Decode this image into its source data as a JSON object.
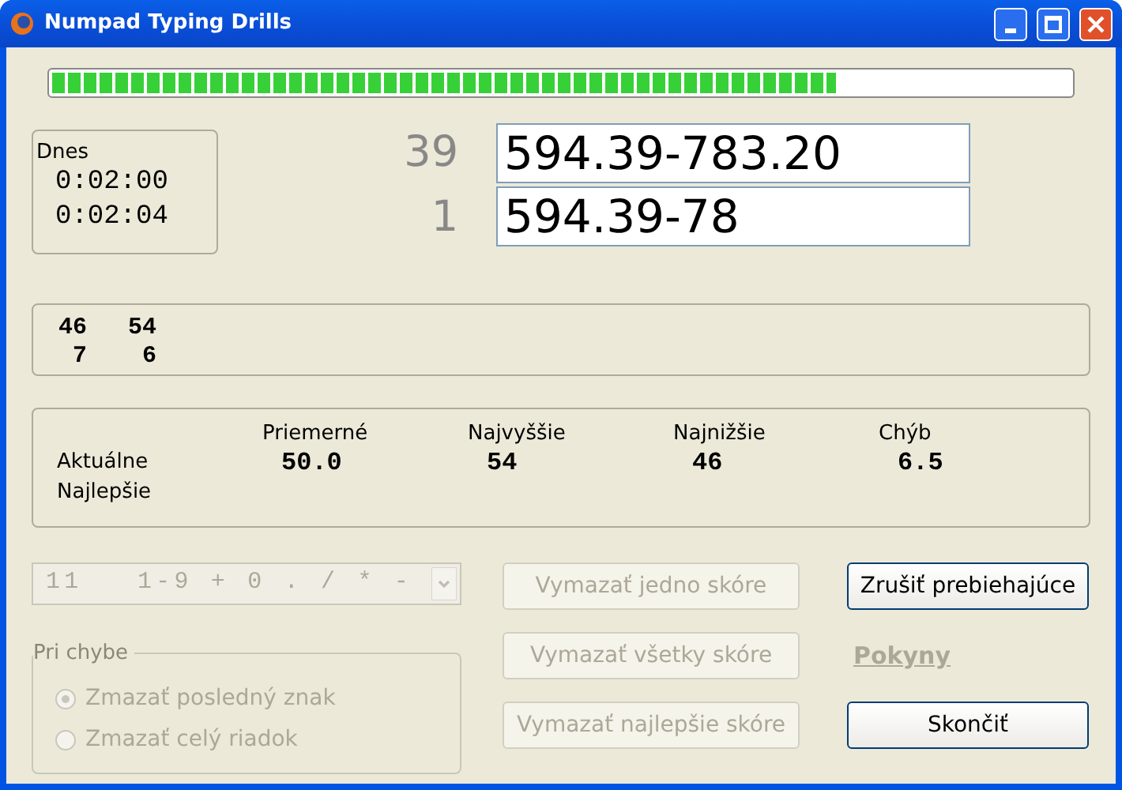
{
  "window": {
    "title": "Numpad Typing Drills"
  },
  "progress": {
    "level": 0.77
  },
  "today": {
    "label": "Dnes",
    "times": [
      "0:02:00",
      "0:02:04"
    ]
  },
  "lines": [
    {
      "count": "39",
      "text": "594.39-783.20"
    },
    {
      "count": "1",
      "text": "594.39-78"
    }
  ],
  "stats": {
    "rows": [
      [
        "46",
        "54"
      ],
      [
        "7",
        "6"
      ]
    ]
  },
  "scores": {
    "columns": [
      "Priemerné",
      "Najvyššie",
      "Najnižšie",
      "Chýb"
    ],
    "rows": [
      {
        "label": "Aktuálne",
        "values": [
          "50.0",
          "54",
          "46",
          "6.5"
        ]
      },
      {
        "label": "Najlepšie"
      }
    ]
  },
  "drill_select": {
    "value": "11   1-9 + 0 . / * -",
    "disabled": true
  },
  "on_error": {
    "title": "Pri chybe",
    "disabled": true,
    "options": [
      {
        "label": "Zmazať posledný znak",
        "selected": true
      },
      {
        "label": "Zmazať celý riadok",
        "selected": false
      }
    ]
  },
  "buttons": [
    {
      "label": "Vymazať jedno skóre",
      "disabled": true
    },
    {
      "label": "Vymazať všetky skóre",
      "disabled": true
    },
    {
      "label": "Vymazať najlepšie skóre",
      "disabled": true
    }
  ],
  "actions": [
    {
      "kind": "button",
      "label": "Zrušiť prebiehajúce",
      "disabled": false
    },
    {
      "kind": "link",
      "label": "Pokyny",
      "disabled": true
    },
    {
      "kind": "button",
      "label": "Skončiť",
      "disabled": false
    }
  ]
}
